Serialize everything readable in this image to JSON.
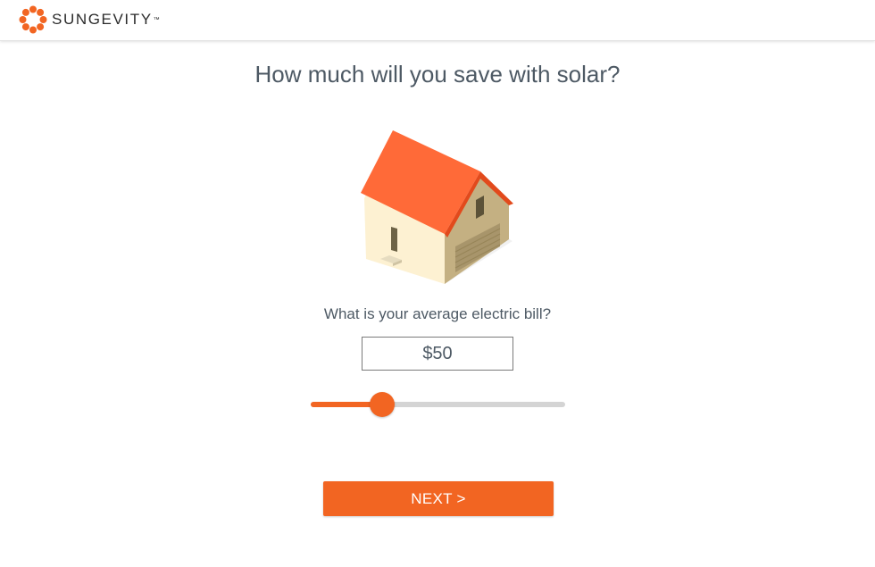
{
  "header": {
    "brand": "SUNGEVITY",
    "trademark": "™",
    "logo_icon": "sun-flower-icon",
    "brand_color": "#f26522"
  },
  "main": {
    "title": "How much will you save with solar?",
    "illustration_icon": "house-icon",
    "question": "What is your average electric bill?",
    "bill_value": "$50",
    "slider": {
      "value_fraction": 0.28,
      "fill_color": "#f26522",
      "track_color": "#d4d4d4"
    },
    "next_label": "NEXT >"
  }
}
